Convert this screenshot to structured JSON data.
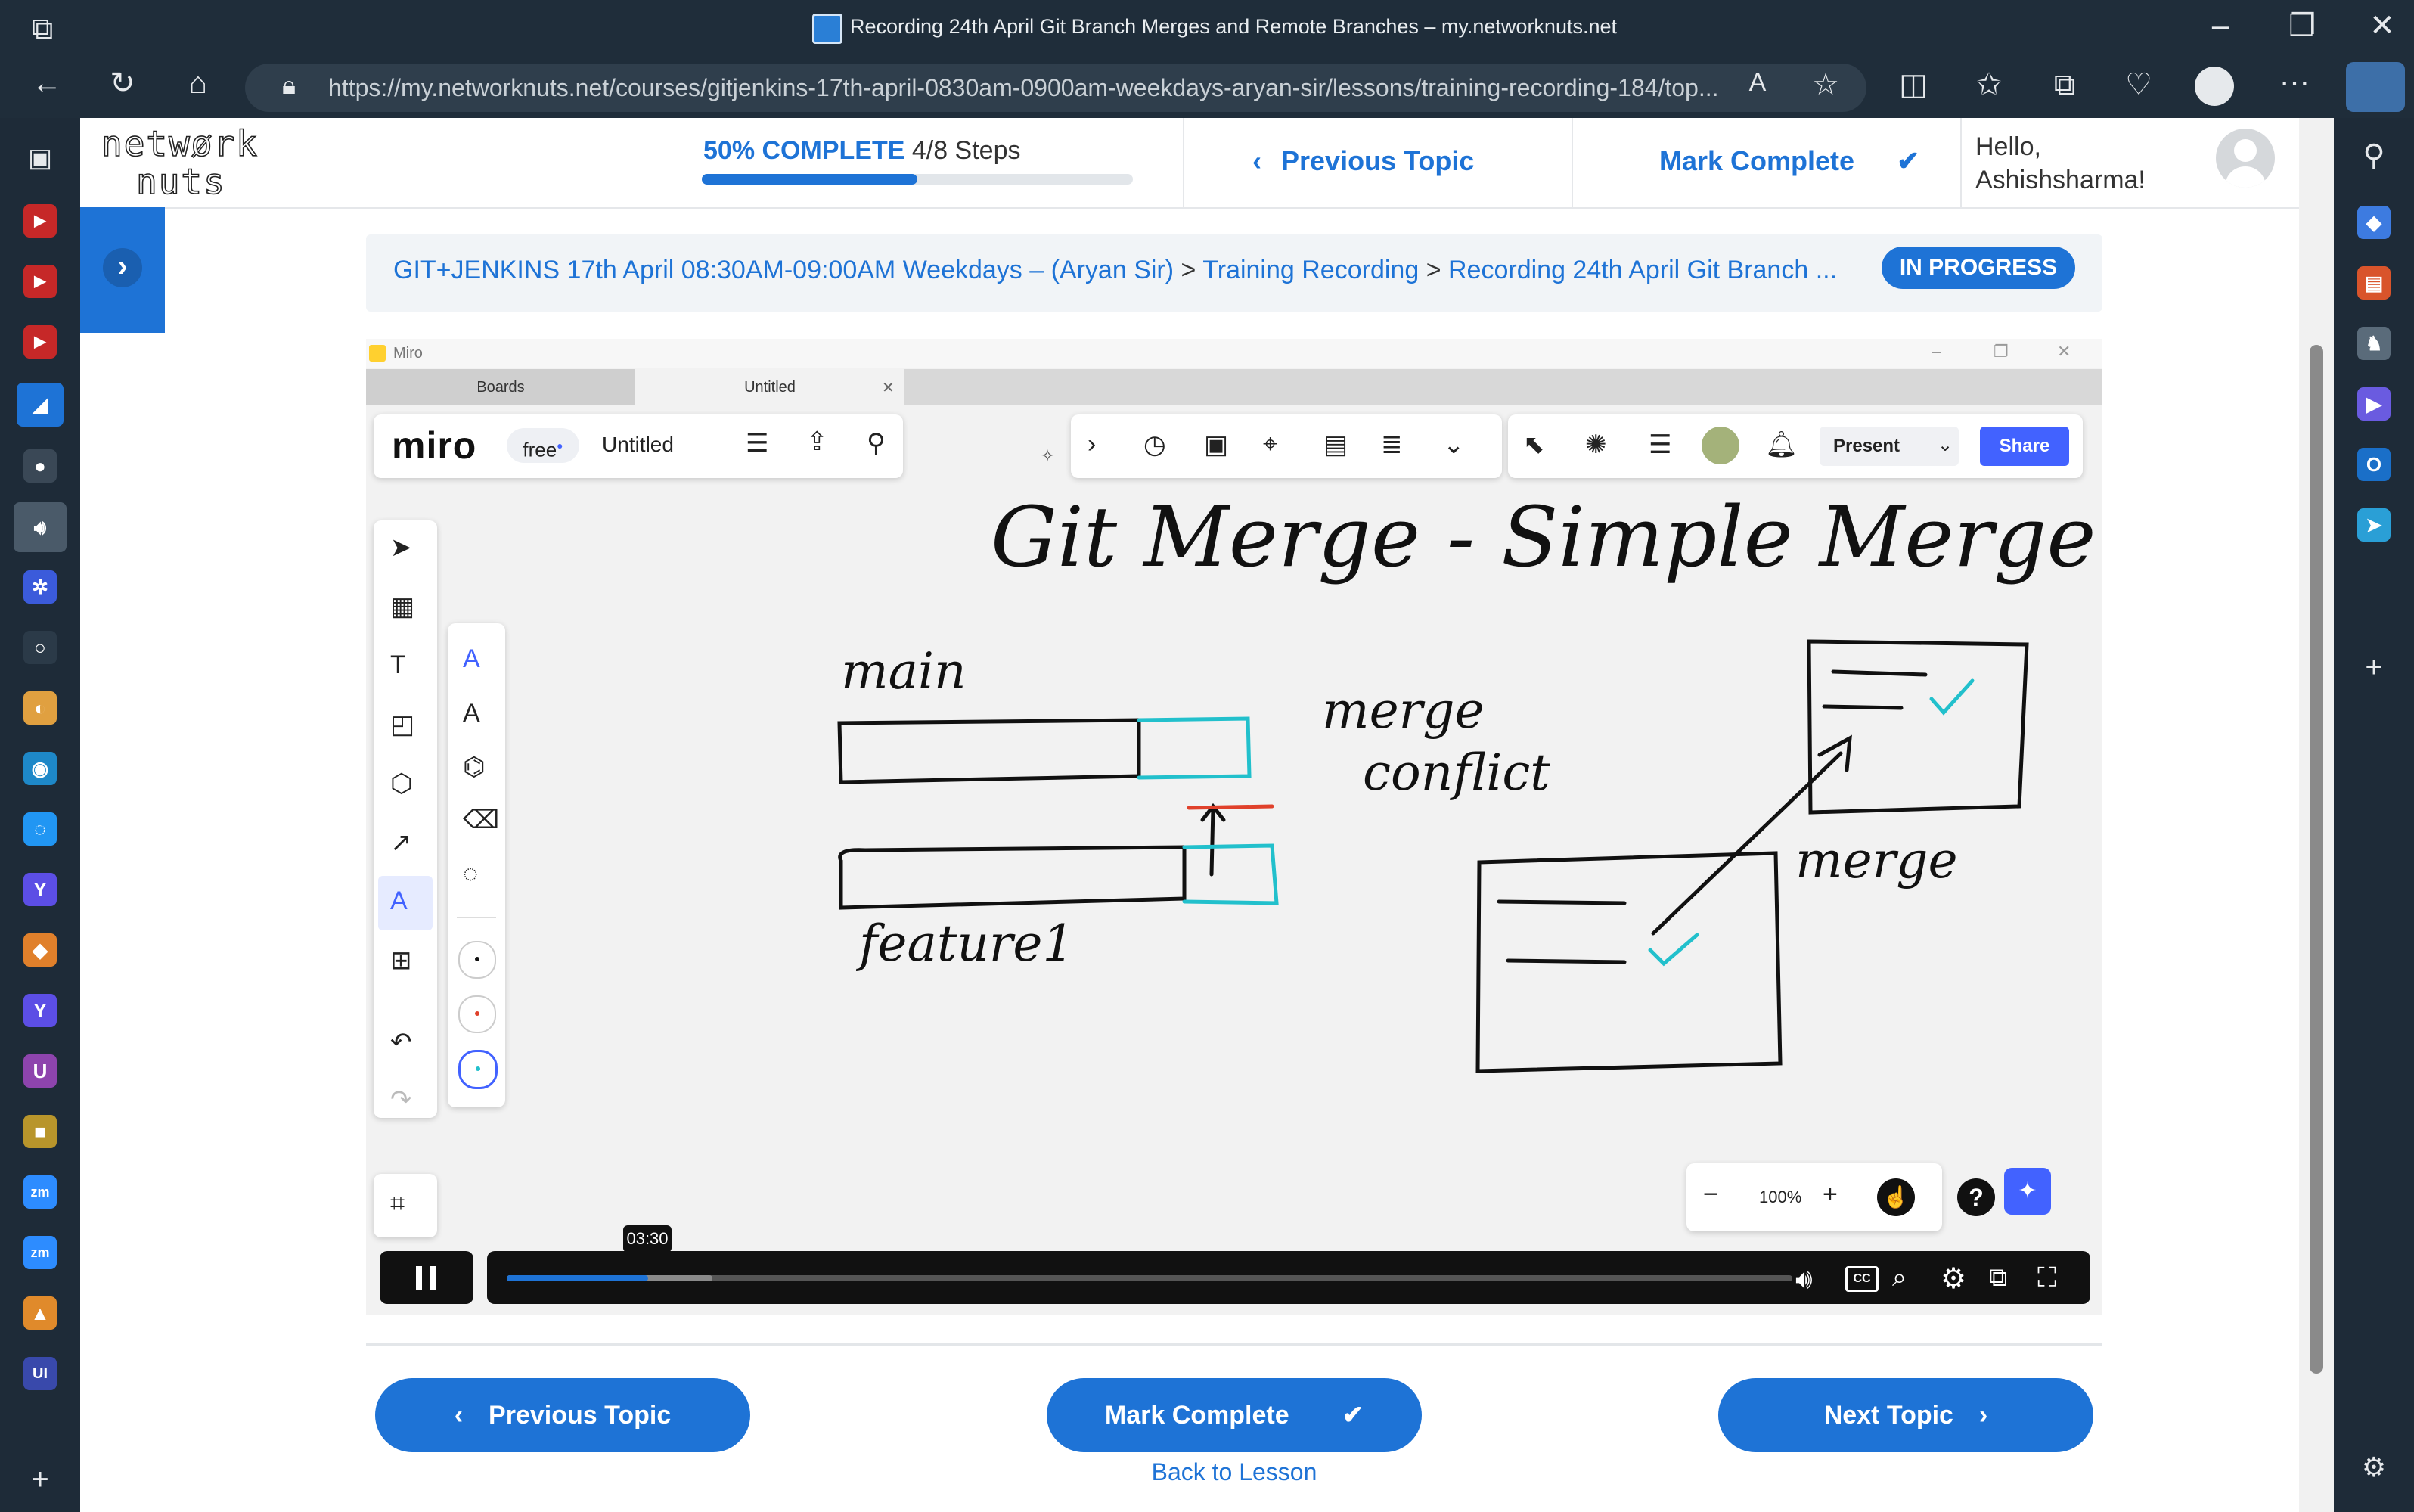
{
  "browser": {
    "tab_title": "Recording 24th April Git Branch Merges and Remote Branches – my.networknuts.net",
    "url": "https://my.networknuts.net/courses/gitjenkins-17th-april-0830am-0900am-weekdays-aryan-sir/lessons/training-recording-184/top...",
    "url_host": "my.networknuts.net"
  },
  "site": {
    "logo_text": "network nuts",
    "progress_text": "50% COMPLETE",
    "progress_steps": "4/8 Steps",
    "progress_fraction": 0.5,
    "previous_topic": "Previous Topic",
    "mark_complete": "Mark Complete",
    "greeting_line1": "Hello,",
    "greeting_line2": "Ashishsharma!"
  },
  "breadcrumb": {
    "course": "GIT+JENKINS 17th April 08:30AM-09:00AM Weekdays – (Aryan Sir)",
    "sep1": ">",
    "lesson": "Training Recording",
    "sep2": ">",
    "topic": "Recording 24th April Git Branch ...",
    "status": "IN PROGRESS"
  },
  "video": {
    "app_window_title": "Miro",
    "tabs": [
      "Boards",
      "Untitled"
    ],
    "miro_logo": "miro",
    "plan_badge": "free",
    "board_name": "Untitled",
    "present_label": "Present",
    "share_label": "Share",
    "zoom_level": "100%",
    "time_tooltip": "03:30",
    "played_fraction": 0.11,
    "buffered_fraction": 0.16,
    "handwriting": {
      "title": "Git Merge - Simple Merge",
      "main_label": "main",
      "feature_label": "feature1",
      "conflict_label1": "merge",
      "conflict_label2": "conflict",
      "merge_label": "merge"
    }
  },
  "footer": {
    "previous_topic": "Previous Topic",
    "mark_complete": "Mark Complete",
    "next_topic": "Next Topic",
    "back_to_lesson": "Back to Lesson"
  },
  "colors": {
    "accent": "#1e73d6",
    "chrome_bg": "#1f2d3a",
    "ink_cyan": "#22c0cc",
    "ink_red": "#e0412b"
  }
}
